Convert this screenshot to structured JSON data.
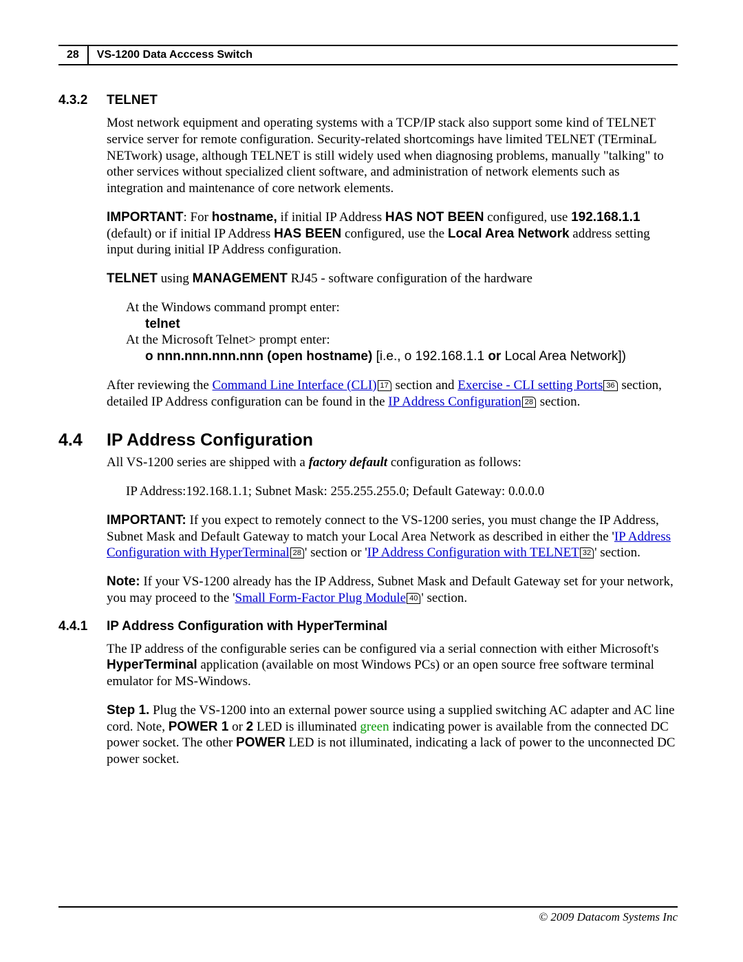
{
  "header": {
    "page_number": "28",
    "title": "VS-1200 Data Acccess Switch"
  },
  "s432": {
    "num": "4.3.2",
    "title": "TELNET",
    "p1": "Most network equipment and operating systems with a TCP/IP stack also support some kind of TELNET service server for remote configuration. Security-related shortcomings have limited TELNET (TErminaL NETwork) usage, although TELNET is still widely used when diagnosing problems, manually \"talking\" to other services without specialized client software, and administration of network elements such as integration and maintenance of core network elements.",
    "p2a": "IMPORTANT",
    "p2b": ": For ",
    "p2c": "hostname,",
    "p2d": " if initial IP Address ",
    "p2e": "HAS NOT BEEN",
    "p2f": " configured, use ",
    "p2g": "192.168.1.1",
    "p2h": " (default) or if initial IP Address ",
    "p2i": "HAS BEEN",
    "p2j": " configured, use the ",
    "p2k": "Local Area Network",
    "p2l": " address setting input during initial IP Address configuration.",
    "p3a": "TELNET",
    "p3b": " using ",
    "p3c": "MANAGEMENT",
    "p3d": " RJ45 -  software configuration of the hardware",
    "cmd1": "At the Windows command prompt enter:",
    "cmd2": "telnet",
    "cmd3": "At the Microsoft Telnet> prompt enter:",
    "cmd4a": "o nnn.nnn.nnn.nnn (open hostname)",
    "cmd4b": " [i.e., o 192.168.1.1 ",
    "cmd4c": "or",
    "cmd4d": " Local Area Network])",
    "p4a": "After reviewing the ",
    "p4link1": "Command Line Interface (CLI)",
    "p4ref1": "17",
    "p4b": " section and ",
    "p4link2": "Exercise - CLI setting Ports",
    "p4ref2": "36",
    "p4c": " section, detailed IP Address configuration can be found in the ",
    "p4link3": "IP Address Configuration",
    "p4ref3": "28",
    "p4d": " section."
  },
  "s44": {
    "num": "4.4",
    "title": "IP Address Configuration",
    "p1a": "All VS-1200 series are shipped with a ",
    "p1b": "factory default",
    "p1c": " configuration as follows:",
    "defaults": "IP Address:192.168.1.1; Subnet Mask: 255.255.255.0; Default Gateway: 0.0.0.0",
    "p2a": "IMPORTANT:",
    "p2b": " If you expect to remotely connect to the VS-1200 series, you must change the IP Address, Subnet Mask and Default Gateway to match your Local Area Network as described in either the '",
    "p2link1": "IP Address Configuration with HyperTerminal",
    "p2ref1": "28",
    "p2c": "' section or '",
    "p2link2": "IP Address Configuration with TELNET",
    "p2ref2": "32",
    "p2d": "' section.",
    "p3a": "Note:",
    "p3b": " If your VS-1200 already has the IP Address, Subnet Mask and Default Gateway set for your network, you may proceed to the '",
    "p3link1": "Small Form-Factor Plug Module",
    "p3ref1": "40",
    "p3c": "' section."
  },
  "s441": {
    "num": "4.4.1",
    "title": "IP Address Configuration with HyperTerminal",
    "p1a": "The IP address of the configurable series can be configured via a serial connection with either Microsoft's ",
    "p1b": "HyperTerminal",
    "p1c": " application (available on most Windows PCs) or an open source free software terminal emulator for MS-Windows.",
    "p2a": "Step 1.",
    "p2b": " Plug the VS-1200 into an external power source using a supplied switching AC adapter and AC line cord. Note, ",
    "p2c": "POWER 1",
    "p2d": " or ",
    "p2e": "2",
    "p2f": " LED is illuminated ",
    "p2g": "green",
    "p2h": " indicating power is available from the connected DC power socket. The other ",
    "p2i": "POWER",
    "p2j": " LED is not illuminated, indicating a lack of power to the unconnected DC power socket."
  },
  "footer": "© 2009 Datacom Systems Inc"
}
